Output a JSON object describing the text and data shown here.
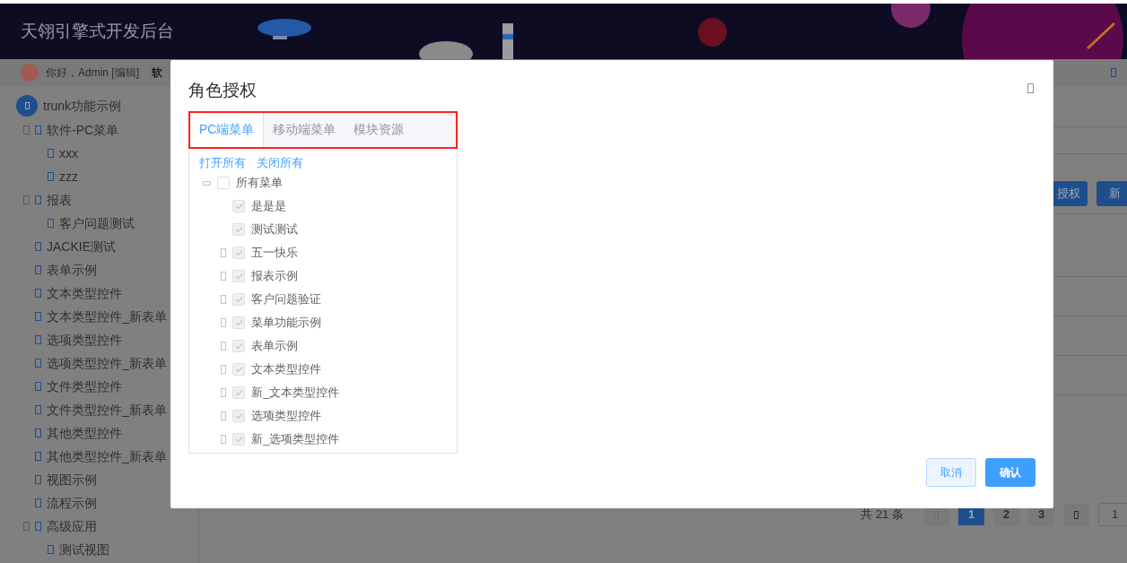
{
  "header": {
    "title": "天翎引擎式开发后台"
  },
  "user_bar": {
    "greeting": "你好，Admin [编辑]",
    "menu_label": "软"
  },
  "sidebar": {
    "root": "trunk功能示例",
    "items": [
      {
        "label": "软件-PC菜单",
        "children": [
          {
            "label": "xxx"
          },
          {
            "label": "zzz"
          }
        ]
      },
      {
        "label": "报表",
        "children": [
          {
            "label": "客户问题测试"
          }
        ]
      },
      {
        "label": "JACKIE测试"
      },
      {
        "label": "表单示例"
      },
      {
        "label": "文本类型控件"
      },
      {
        "label": "文本类型控件_新表单"
      },
      {
        "label": "选项类型控件"
      },
      {
        "label": "选项类型控件_新表单"
      },
      {
        "label": "文件类型控件"
      },
      {
        "label": "文件类型控件_新表单"
      },
      {
        "label": "其他类型控件"
      },
      {
        "label": "其他类型控件_新表单"
      },
      {
        "label": "视图示例"
      },
      {
        "label": "流程示例"
      },
      {
        "label": "高级应用",
        "children": [
          {
            "label": "测试视图"
          }
        ]
      }
    ]
  },
  "toolbar": {
    "buttons": [
      "授权",
      "新"
    ]
  },
  "pagination": {
    "total": "共 21 条",
    "pages": [
      {
        "label": "1",
        "selected": true
      },
      {
        "label": "2",
        "selected": false
      },
      {
        "label": "3",
        "selected": false
      }
    ],
    "page_size": "1"
  },
  "dialog": {
    "title": "角色授权",
    "tabs": [
      {
        "label": "PC端菜单",
        "selected": true
      },
      {
        "label": "移动端菜单",
        "selected": false
      },
      {
        "label": "模块资源",
        "selected": false
      }
    ],
    "links": [
      "打开所有",
      "关闭所有"
    ],
    "tree": {
      "label": "所有菜单",
      "checked": false,
      "expanded": true,
      "children": [
        {
          "label": "是是是",
          "checked": true,
          "expandable": false
        },
        {
          "label": "测试测试",
          "checked": true,
          "expandable": false
        },
        {
          "label": "五一快乐",
          "checked": true,
          "expandable": true
        },
        {
          "label": "报表示例",
          "checked": true,
          "expandable": true
        },
        {
          "label": "客户问题验证",
          "checked": true,
          "expandable": true
        },
        {
          "label": "菜单功能示例",
          "checked": true,
          "expandable": true
        },
        {
          "label": "表单示例",
          "checked": true,
          "expandable": true
        },
        {
          "label": "文本类型控件",
          "checked": true,
          "expandable": true
        },
        {
          "label": "新_文本类型控件",
          "checked": true,
          "expandable": true
        },
        {
          "label": "选项类型控件",
          "checked": true,
          "expandable": true
        },
        {
          "label": "新_选项类型控件",
          "checked": true,
          "expandable": true
        }
      ]
    },
    "buttons": [
      {
        "label": "取消",
        "kind": "secondary"
      },
      {
        "label": "确认",
        "kind": "primary"
      }
    ]
  }
}
